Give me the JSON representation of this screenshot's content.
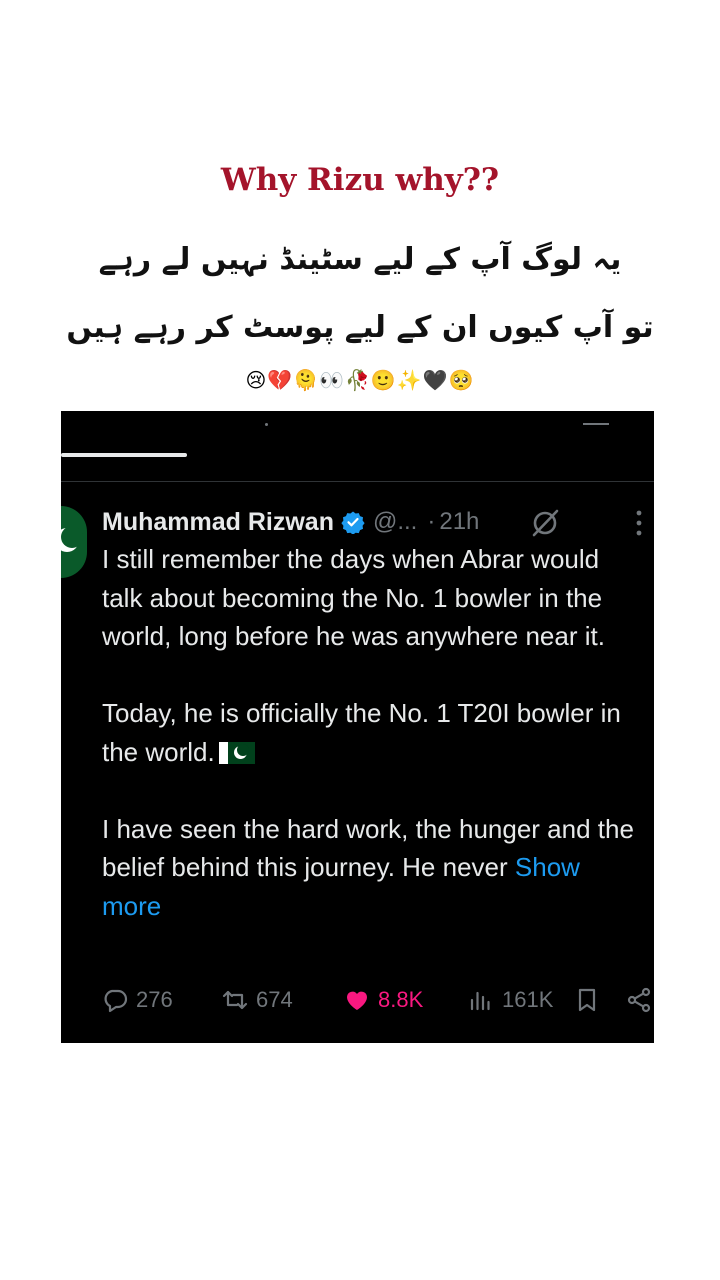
{
  "overlay": {
    "headline": "Why Rizu why??",
    "urdu_line1": "یہ لوگ آپ کے لیے سٹینڈ نہیں لے رہے",
    "urdu_line2": "تو آپ کیوں ان کے لیے پوسٹ کر رہے ہیں",
    "emojis": "😢💔🫠👀🥀🙂✨🖤🥺"
  },
  "tweet": {
    "author_name": "Muhammad Rizwan",
    "handle": "@...",
    "separator": "·",
    "time": "21h",
    "paragraph1": "I still remember the days when Abrar would talk about becoming the No. 1 bowler in the world, long before he was anywhere near it.",
    "paragraph2": "Today, he is officially the No. 1 T20I bowler in the world.",
    "paragraph3": "I have seen the hard work, the hunger and the belief behind this journey. He never",
    "show_more": "Show more",
    "replies": "276",
    "reposts": "674",
    "likes": "8.8K",
    "views": "161K"
  },
  "colors": {
    "headline": "#a4142b",
    "background_dark": "#000000",
    "text": "#e7e9ea",
    "muted": "#71767b",
    "link": "#1d9bf0",
    "like": "#f91880"
  },
  "icons": [
    "verified-badge-icon",
    "grok-icon",
    "more-icon",
    "reply-icon",
    "repost-icon",
    "like-icon",
    "views-icon",
    "bookmark-icon",
    "share-icon",
    "pakistan-flag-icon"
  ]
}
